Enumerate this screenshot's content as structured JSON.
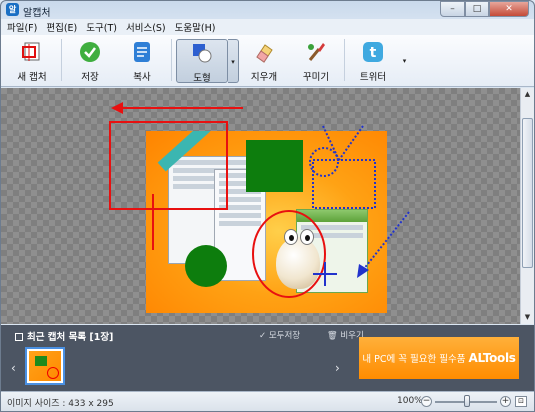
{
  "window": {
    "title": "알캡처",
    "app_icon_letter": "알",
    "controls": {
      "minimize": "–",
      "maximize": "□",
      "close": "✕"
    }
  },
  "menu": [
    "파일(F)",
    "편집(E)",
    "도구(T)",
    "서비스(S)",
    "도움말(H)"
  ],
  "toolbar": {
    "new_capture": "새 캡처",
    "save": "저장",
    "copy": "복사",
    "shape": "도형",
    "eraser": "지우개",
    "decorate": "꾸미기",
    "twitter": "트위터",
    "dropdown_glyph": "▾"
  },
  "colors": {
    "annotation_red": "#e81010",
    "annotation_blue": "#2233cc",
    "shape_green": "#0d7d0d",
    "accent_blue": "#4a90e2",
    "ad_orange": "#ff9a1e"
  },
  "recent": {
    "title": "최근 캡처 목록 [1장]",
    "save_all": "모두저장",
    "clear": "비우기",
    "prev": "‹",
    "next": "›"
  },
  "ad": {
    "text": "내 PC에 꼭 필요한 필수품",
    "brand": "ALTools"
  },
  "status": {
    "image_size": "이미지 사이즈 : 433 x 295",
    "zoom": "100%",
    "zoom_out": "−",
    "zoom_in": "+"
  },
  "scrollbar": {
    "up": "▲",
    "down": "▼"
  }
}
